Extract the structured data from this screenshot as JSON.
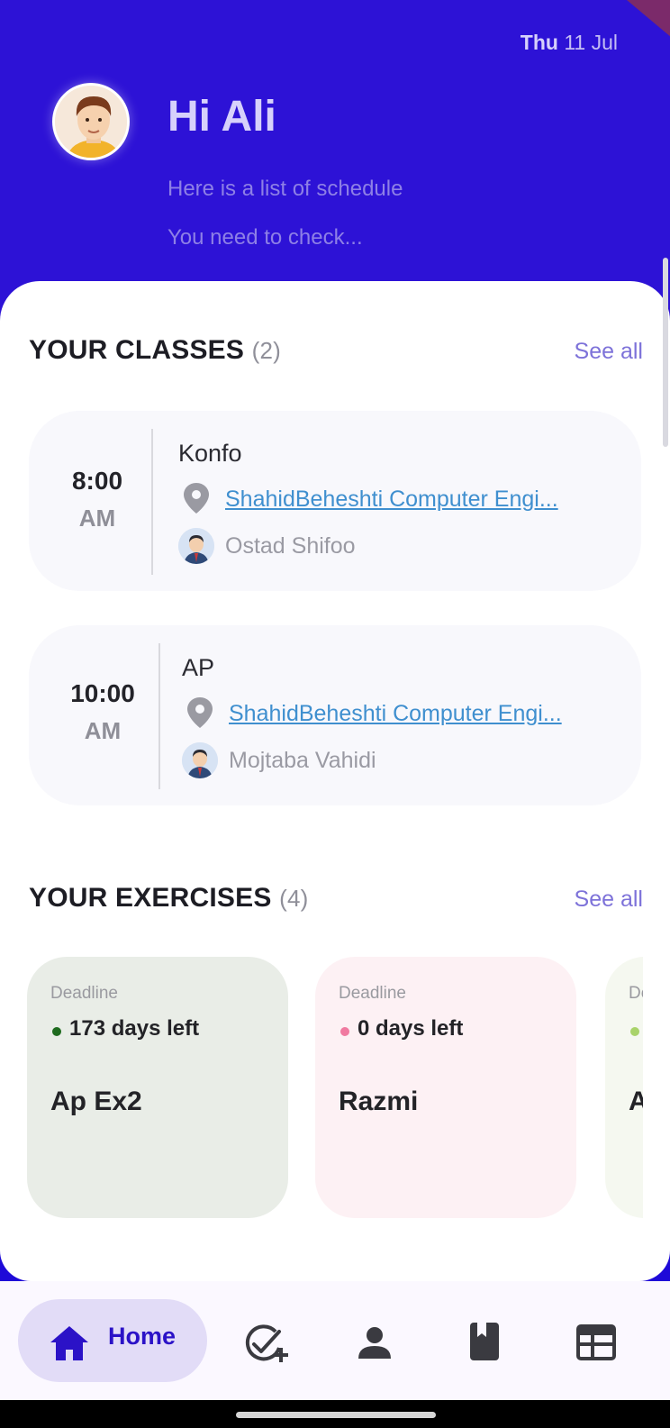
{
  "header": {
    "date_day": "Thu",
    "date_rest": " 11 Jul",
    "greeting": "Hi Ali",
    "subtitle_line1": "Here is a list of schedule",
    "subtitle_line2": "You need to check..."
  },
  "classes_section": {
    "title": "YOUR CLASSES",
    "count": "(2)",
    "see_all": "See all",
    "items": [
      {
        "time": "8:00",
        "period": "AM",
        "course": "Konfo",
        "location": "ShahidBeheshti Computer Engi...",
        "teacher": "Ostad Shifoo"
      },
      {
        "time": "10:00",
        "period": "AM",
        "course": "AP",
        "location": "ShahidBeheshti Computer Engi...",
        "teacher": "Mojtaba Vahidi"
      }
    ]
  },
  "exercises_section": {
    "title": "YOUR EXERCISES",
    "count": "(4)",
    "see_all": "See all",
    "items": [
      {
        "deadline_label": "Deadline",
        "days_left": "173 days left",
        "name": "Ap Ex2",
        "card_color": "#e9ede7",
        "dot_color": "#1f6b1f"
      },
      {
        "deadline_label": "Deadline",
        "days_left": "0 days left",
        "name": "Razmi",
        "card_color": "#fdf1f4",
        "dot_color": "#f07aa0"
      },
      {
        "deadline_label": "De",
        "days_left": "",
        "name": "A",
        "card_color": "#f5f8f0",
        "dot_color": "#a9d36a"
      }
    ]
  },
  "bottom_nav": {
    "home_label": "Home",
    "icons": [
      "home-icon",
      "add-task-icon",
      "person-icon",
      "book-icon",
      "calendar-table-icon"
    ]
  },
  "colors": {
    "header_bg": "#2d12d6",
    "accent": "#2b12c7",
    "link": "#3f8fcf"
  }
}
